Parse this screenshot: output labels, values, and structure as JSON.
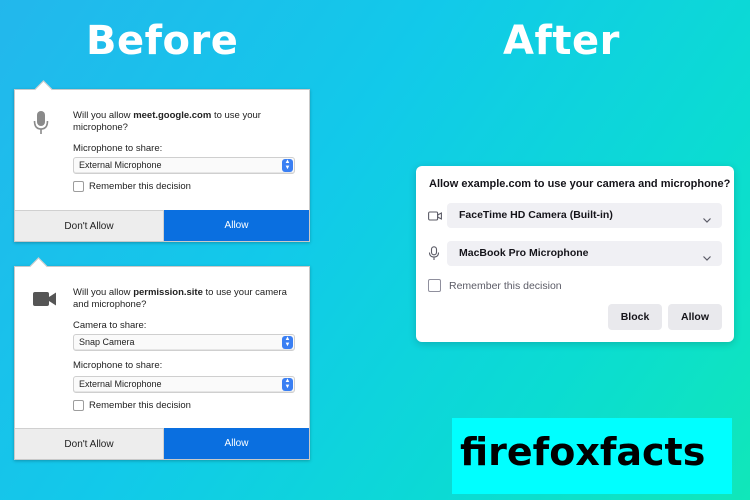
{
  "headings": {
    "before": "Before",
    "after": "After"
  },
  "old_dialog_1": {
    "question_prefix": "Will you allow ",
    "site": "meet.google.com",
    "question_suffix": " to use your microphone?",
    "mic_label": "Microphone to share:",
    "mic_value": "External Microphone",
    "remember": "Remember this decision",
    "deny": "Don't Allow",
    "allow": "Allow"
  },
  "old_dialog_2": {
    "question_prefix": "Will you allow ",
    "site": "permission.site",
    "question_suffix": " to use your camera and microphone?",
    "camera_label": "Camera to share:",
    "camera_value": "Snap Camera",
    "mic_label": "Microphone to share:",
    "mic_value": "External Microphone",
    "remember": "Remember this decision",
    "deny": "Don't Allow",
    "allow": "Allow"
  },
  "new_dialog": {
    "title": "Allow example.com to use your camera and microphone?",
    "camera_value": "FaceTime HD Camera (Built-in)",
    "mic_value": "MacBook Pro Microphone",
    "remember": "Remember this decision",
    "block": "Block",
    "allow": "Allow"
  },
  "brand": "firefoxfacts",
  "icons": [
    "microphone-icon",
    "camera-icon",
    "video-camera-icon",
    "chevron-down-icon",
    "select-stepper-icon"
  ],
  "colors": {
    "allow_blue": "#0a6fe0",
    "brand_box": "#00ffff"
  }
}
